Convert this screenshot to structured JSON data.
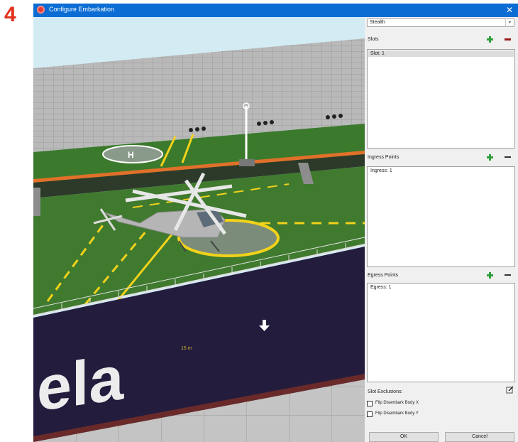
{
  "step_number": "4",
  "window": {
    "title": "Configure Embarkation",
    "close_glyph": "✕"
  },
  "viewport": {
    "hull_text": "ela",
    "distance_readout": "15 m",
    "helipad_letter": "H",
    "colors": {
      "sky": "#cfeaf5",
      "deck_green": "#3f7a2e",
      "hull": "#231c3d",
      "stripe_yellow": "#f2d21b",
      "stripe_orange": "#e0702a"
    }
  },
  "panel": {
    "dropdown_value": "Stealth",
    "slots": {
      "label": "Slots",
      "items": [
        "Slot: 1"
      ]
    },
    "ingress": {
      "label": "Ingress Points",
      "items": [
        "Ingress: 1"
      ]
    },
    "egress": {
      "label": "Egress Points",
      "items": [
        "Egress: 1"
      ]
    },
    "slot_exclusions": {
      "label": "Slot Exclusions:"
    },
    "checkboxes": [
      {
        "label": "Flip Disembark Body X",
        "checked": false
      },
      {
        "label": "Flip Disembark Body Y",
        "checked": false
      }
    ],
    "ok_label": "OK",
    "cancel_label": "Cancel",
    "icons": {
      "add": "plus-green-icon",
      "remove": "minus-icon",
      "edit": "edit-icon"
    }
  }
}
